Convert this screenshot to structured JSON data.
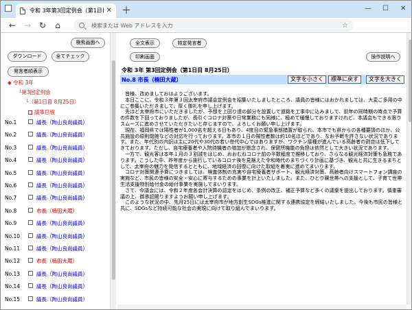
{
  "browser": {
    "tab_title": "令和 3年第3回定例会（第1日目",
    "address_placeholder": "検索または Web アドレスを入力"
  },
  "left": {
    "search_button": "検索画面へ",
    "download_button": "ダウンロード",
    "check_all_button": "全てチェック",
    "speaker_list_button": "発言者順表示",
    "tree": {
      "year": "令和 3年",
      "session": "第3回定例会",
      "day": "（第1日目 8月25日）",
      "agenda": "議事日程"
    },
    "speeches": [
      {
        "no": "No.1",
        "name": "議長（陶山良尚議員）",
        "role": "chair"
      },
      {
        "no": "No.2",
        "name": "議長（陶山良尚議員）",
        "role": "chair"
      },
      {
        "no": "No.3",
        "name": "議長（陶山良尚議員）",
        "role": "chair"
      },
      {
        "no": "No.4",
        "name": "議長（陶山良尚議員）",
        "role": "chair"
      },
      {
        "no": "No.5",
        "name": "議長（陶山良尚議員）",
        "role": "chair"
      },
      {
        "no": "No.6",
        "name": "議長（陶山良尚議員）",
        "role": "chair"
      },
      {
        "no": "No.7",
        "name": "議長（陶山良尚議員）",
        "role": "chair"
      },
      {
        "no": "No.8",
        "name": "市長（楠田大蔵）",
        "role": "mayor"
      },
      {
        "no": "No.9",
        "name": "議長（陶山良尚議員）",
        "role": "chair"
      },
      {
        "no": "No.10",
        "name": "議長（陶山良尚議員）",
        "role": "chair"
      },
      {
        "no": "No.11",
        "name": "議長（陶山良尚議員）",
        "role": "chair"
      },
      {
        "no": "No.12",
        "name": "市長（楠田大蔵）",
        "role": "mayor"
      },
      {
        "no": "No.13",
        "name": "議長（陶山良尚議員）",
        "role": "chair"
      },
      {
        "no": "No.14",
        "name": "議長（陶山良尚議員）",
        "role": "chair"
      },
      {
        "no": "No.15",
        "name": "議長（陶山良尚議員）",
        "role": "chair"
      }
    ]
  },
  "right": {
    "show_all_button": "全文表示",
    "specific_speaker_button": "特定発言者",
    "print_button": "印刷画面",
    "operation_button": "操作説明へ",
    "meeting_title": "令和 3年 第3回定例会（第1日目 8月25日）",
    "speaker_heading": "No.8 市長（楠田大蔵）",
    "smaller_button": "文字を小さく",
    "standard_button": "標準に戻す",
    "larger_button": "文字を大きく",
    "paragraphs": [
      "皆様、改めましておはようございます。",
      "本日ここに、令和３年第３回太宰府市議会定例会を招集いたしましたところ、議員の皆様にはおかれましては、大変ご多用の中にご参集いただきまして、厚く御礼を申し上げます。",
      "先ほど太宰府市にいただきましたが、予想を上回り道の部分を設置して道路を工事中に込みまして、前年の同時期の時点で予算の件数を下回っておりましたが、長引くコロナ対策や日常業務にも同様に、極めて緩慢しておりますけれど、本議会もできる限りスムーズに進めさせていただきたいと存じますので、よろしくお願い申し上げます。",
      "現在、福岡県では陽性者が1,000名を超える日もあり、4度目の緊急事態措置が取られ、本市でも県からの各種要請のほか、公共施設の原則閉館などの対応を行っております。本市の１日の陽性者数は約10名ほどであり、なお予断を許さない状況であります。また、年代別の内訳は主に20代や30代の若い世代中心ではありますが、ワクチン接種が進んでいる高齢者の割合は低下してきております。ただし、自宅療養者や入院待機者の増加が懸念され、保健所機能の負担は依然として大きい状況であります。",
      "一方で、観光客は本年１月の３割減をはじめ、おおむねコロナ前の半数程度で推移しており、さらなる観光経済対策も急務であります。こうした中、昨年度から施行しているコロナ後を見据えた令和時代のまちづくり計画に基づき、観光と共に生きるまちとして、太宰府の魅力を発信するとともに、地域経済の回復に向けた取組を着実に進めてまいります。",
      "コロナ対策関連予算につきましては、検査体制の充実や自宅療養者サポート、観光経済対策、高齢者向けスマートフォン講座の実施など、市民の皆様の安全・安心に寄与するための事業を計上いたしました。また、ひとり親世帯への支援として、子育て世帯生活支援特別給付金の給付事業を実施してまいります。",
      "さて、今議会には、令和２年度各会計決算の認定をはじめ、条例の改正、補正予算など多くの議案を提出しております。慎重審議の上、御承認賜りますようお願い申し上げます。",
      "このような状況の中、先月25日には太宰府市が地方創生SDGs推進に関する連携協定を締結いたしました。今後も市民の皆様と共に、SDGsなど持続可能な社会の実現に向けて取り組んでまいります。"
    ]
  }
}
